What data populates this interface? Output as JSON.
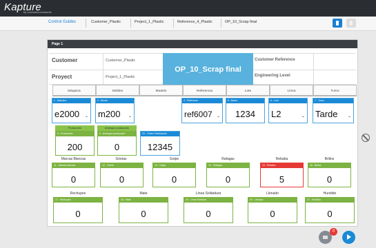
{
  "app": {
    "logo": "Kapture",
    "logo_sub": "by Lexmark/Lucidworks"
  },
  "breadcrumbs": [
    "Control Guides",
    "Customer_Plastic",
    "Project_1_Plastic",
    "Reference_4_Plastic",
    "OP_10_Scrap final"
  ],
  "panel_title": "Page 1",
  "header": {
    "customer_label": "Customer",
    "customer_value": "Customer_Plastic",
    "project_label": "Proyect",
    "project_value": "Project_1_Plastic",
    "op_title": "OP_10_Scrap final",
    "customer_ref_label": "Customer Reference",
    "engineering_label": "Engineering Level"
  },
  "columns": [
    "Máquina",
    "Moldes",
    "Modelo",
    "Referencia",
    "Lote",
    "Línea",
    "Turno"
  ],
  "selectors": [
    {
      "title": "1 - Machine",
      "value": "e2000",
      "dropdown": true
    },
    {
      "title": "2 - Mould",
      "value": "m200",
      "dropdown": true
    },
    {
      "title": "4 - Reference",
      "value": "ref6007",
      "dropdown": true
    },
    {
      "title": "5 - Batch",
      "value": "1234",
      "dropdown": false
    },
    {
      "title": "6 - Line",
      "value": "L2",
      "dropdown": true
    },
    {
      "title": "7 - Turno",
      "value": "Tarde",
      "dropdown": true
    }
  ],
  "production": {
    "prod_tag": "Producción",
    "prod_title": "8 - Producción",
    "prod_value": "200",
    "arr_tag": "Arranque producción",
    "arr_title": "9 - Arranque producción",
    "arr_value": "0",
    "orden_title": "10 - Orden Fabricación",
    "orden_value": "12345"
  },
  "defects_row1": [
    {
      "label": "Marcas Blancas",
      "title": "11 - Marcas blancas",
      "value": "0",
      "alert": false
    },
    {
      "label": "Grietas",
      "title": "12 - Grieta",
      "value": "0",
      "alert": false
    },
    {
      "label": "Golpe",
      "title": "13 - Golpe",
      "value": "0",
      "alert": false
    },
    {
      "label": "Rafagas",
      "title": "14 - Rafagas",
      "value": "0",
      "alert": false
    },
    {
      "label": "Rebaba",
      "title": "15 - Rebaba",
      "value": "5",
      "alert": true
    },
    {
      "label": "Brillos",
      "title": "16 - Brillos",
      "value": "0",
      "alert": false
    }
  ],
  "defects_row2": [
    {
      "label": "Rechupes",
      "title": "17 - Rechupes",
      "value": "0"
    },
    {
      "label": "Mate",
      "title": "18 - Mate",
      "value": "0"
    },
    {
      "label": "Línea Soldadura",
      "title": "19 - Línea Partición",
      "value": "0"
    },
    {
      "label": "Llenado",
      "title": "20 - Llenado",
      "value": "0"
    },
    {
      "label": "Hundido",
      "title": "21 - Hundido",
      "value": "0"
    }
  ],
  "notifications": {
    "count": "0"
  },
  "colors": {
    "accent": "#1a8ad6",
    "ok": "#7cb342",
    "alert": "#e53935",
    "op_banner": "#58b2dd"
  }
}
